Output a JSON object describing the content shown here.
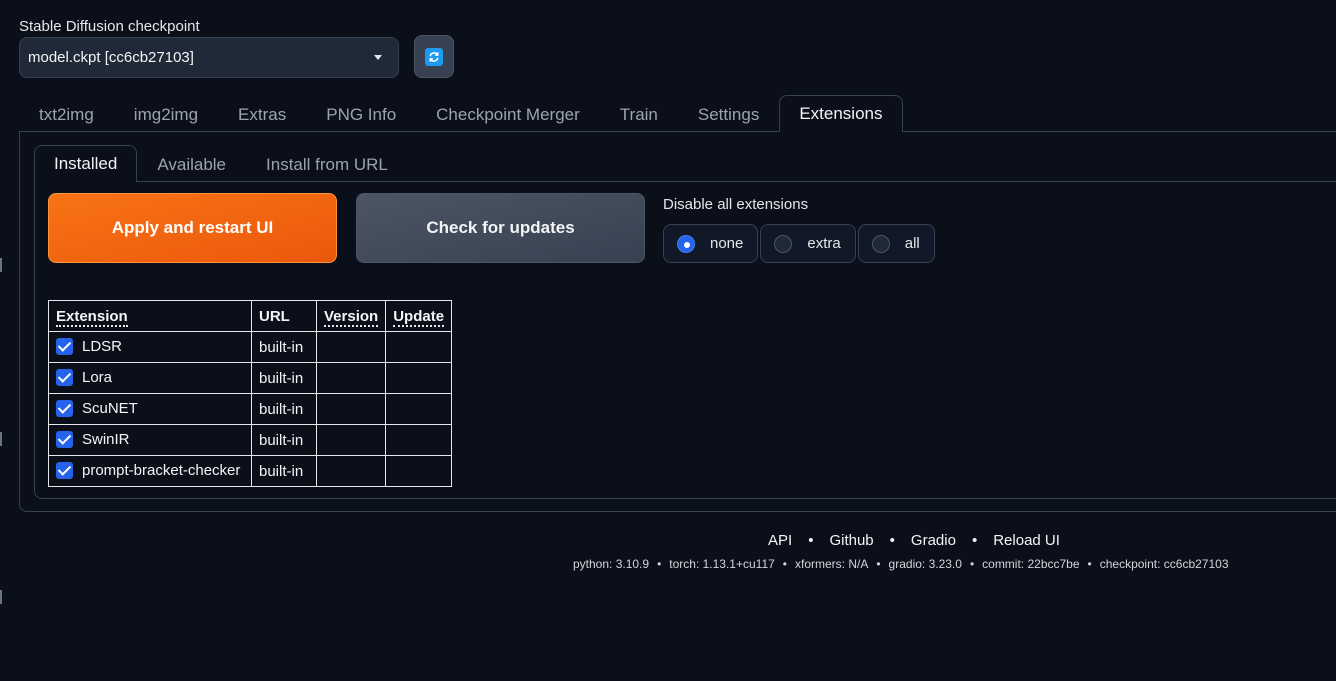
{
  "checkpoint": {
    "label": "Stable Diffusion checkpoint",
    "value": "model.ckpt [cc6cb27103]"
  },
  "main_tabs": [
    {
      "label": "txt2img",
      "active": false
    },
    {
      "label": "img2img",
      "active": false
    },
    {
      "label": "Extras",
      "active": false
    },
    {
      "label": "PNG Info",
      "active": false
    },
    {
      "label": "Checkpoint Merger",
      "active": false
    },
    {
      "label": "Train",
      "active": false
    },
    {
      "label": "Settings",
      "active": false
    },
    {
      "label": "Extensions",
      "active": true
    }
  ],
  "sub_tabs": [
    {
      "label": "Installed",
      "active": true
    },
    {
      "label": "Available",
      "active": false
    },
    {
      "label": "Install from URL",
      "active": false
    }
  ],
  "buttons": {
    "apply": "Apply and restart UI",
    "check": "Check for updates"
  },
  "disable": {
    "label": "Disable all extensions",
    "options": [
      {
        "label": "none",
        "checked": true
      },
      {
        "label": "extra",
        "checked": false
      },
      {
        "label": "all",
        "checked": false
      }
    ]
  },
  "table": {
    "headers": [
      "Extension",
      "URL",
      "Version",
      "Update"
    ],
    "rows": [
      {
        "name": "LDSR",
        "url": "built-in",
        "version": "",
        "update": "",
        "enabled": true
      },
      {
        "name": "Lora",
        "url": "built-in",
        "version": "",
        "update": "",
        "enabled": true
      },
      {
        "name": "ScuNET",
        "url": "built-in",
        "version": "",
        "update": "",
        "enabled": true
      },
      {
        "name": "SwinIR",
        "url": "built-in",
        "version": "",
        "update": "",
        "enabled": true
      },
      {
        "name": "prompt-bracket-checker",
        "url": "built-in",
        "version": "",
        "update": "",
        "enabled": true
      }
    ]
  },
  "footer": {
    "links": [
      "API",
      "Github",
      "Gradio",
      "Reload UI"
    ],
    "versions": [
      "python: 3.10.9",
      "torch: 1.13.1+cu117",
      "xformers: N/A",
      "gradio: 3.23.0",
      "commit: 22bcc7be",
      "checkpoint: cc6cb27103"
    ]
  },
  "colors": {
    "background": "#0b0f19",
    "primary_button": "#f97316",
    "secondary_button": "#4b5563",
    "accent": "#2563eb"
  },
  "icons": {
    "refresh": "refresh-icon",
    "dropdown": "chevron-down-icon"
  }
}
